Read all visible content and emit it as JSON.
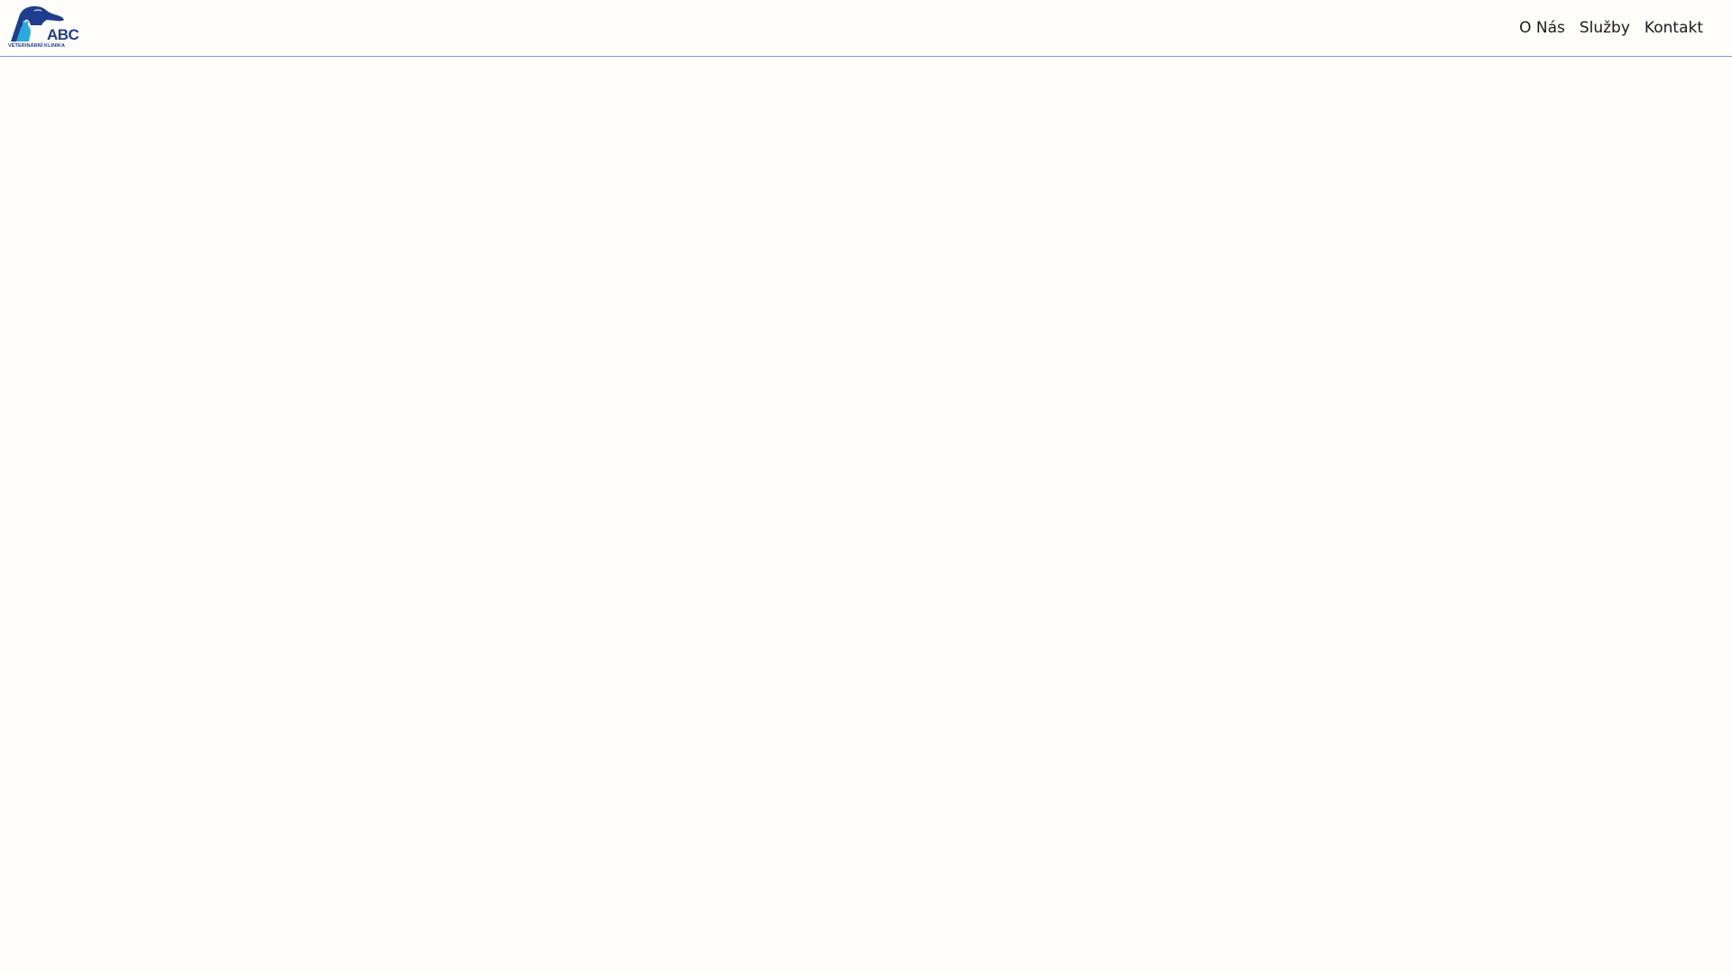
{
  "header": {
    "logo": {
      "icon": "dog-and-cat-silhouette-logo",
      "text": "ABC",
      "subtitle": "VETERINÁRNÍ KLINIKA",
      "color": "#1f3d8f",
      "accent_color": "#2aa9e0"
    },
    "nav": {
      "items": [
        {
          "label": "O Nás"
        },
        {
          "label": "Služby"
        },
        {
          "label": "Kontakt"
        }
      ]
    },
    "border_color": "#6aa6e6"
  },
  "page": {
    "background": "#fefdfa"
  }
}
